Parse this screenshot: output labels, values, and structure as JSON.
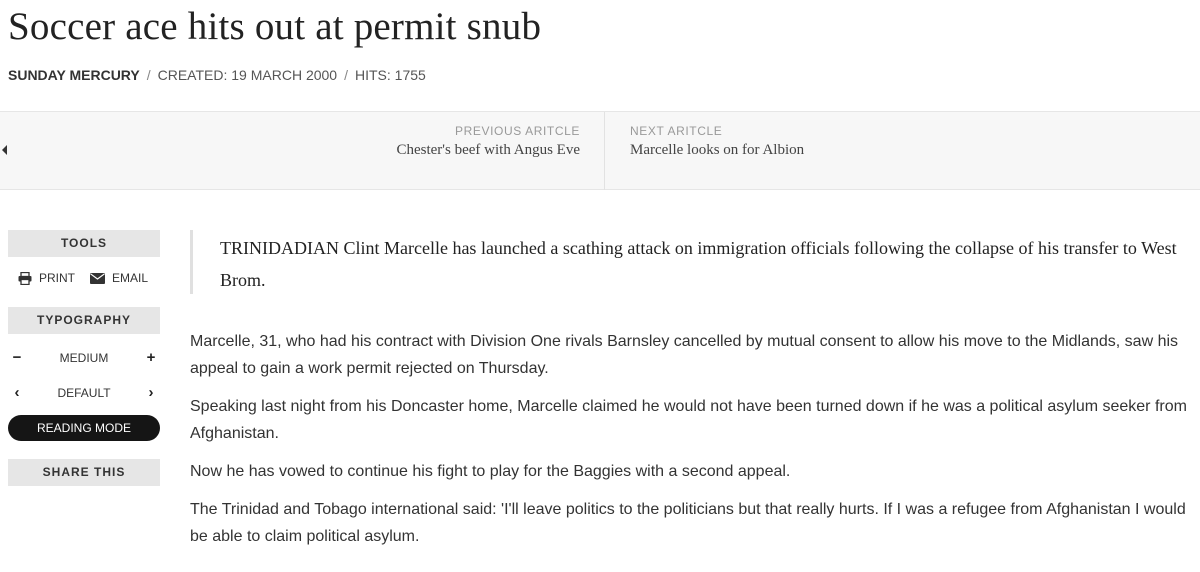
{
  "article": {
    "title": "Soccer ace hits out at permit snub",
    "source": "Sunday Mercury",
    "created": "Created: 19 March 2000",
    "hits": "Hits: 1755"
  },
  "pager": {
    "prev_label": "Previous Aritcle",
    "prev_title": "Chester's beef with Angus Eve",
    "next_label": "Next Aritcle",
    "next_title": "Marcelle looks on for Albion"
  },
  "tools": {
    "header": "Tools",
    "print": "Print",
    "email": "Email",
    "typography_header": "Typography",
    "size_value": "Medium",
    "font_value": "Default",
    "reading_mode": "Reading Mode",
    "share": "Share This"
  },
  "content": {
    "lead": "TRINIDADIAN Clint Marcelle has launched a scathing attack on immigration officials following the collapse of his transfer to West Brom.",
    "paragraphs": [
      "Marcelle, 31, who had his contract with Division One rivals Barnsley cancelled by mutual consent to allow his move to the Midlands, saw his appeal to gain a work permit rejected on Thursday.",
      "Speaking last night from his Doncaster home, Marcelle claimed he would not have been turned down if he was a political asylum seeker from Afghanistan.",
      "Now he has vowed to continue his fight to play for the Baggies with a second appeal.",
      "The Trinidad and Tobago international said: 'I'll leave politics to the politicians but that really hurts. If I was a refugee from Afghanistan I would be able to claim political asylum."
    ]
  }
}
